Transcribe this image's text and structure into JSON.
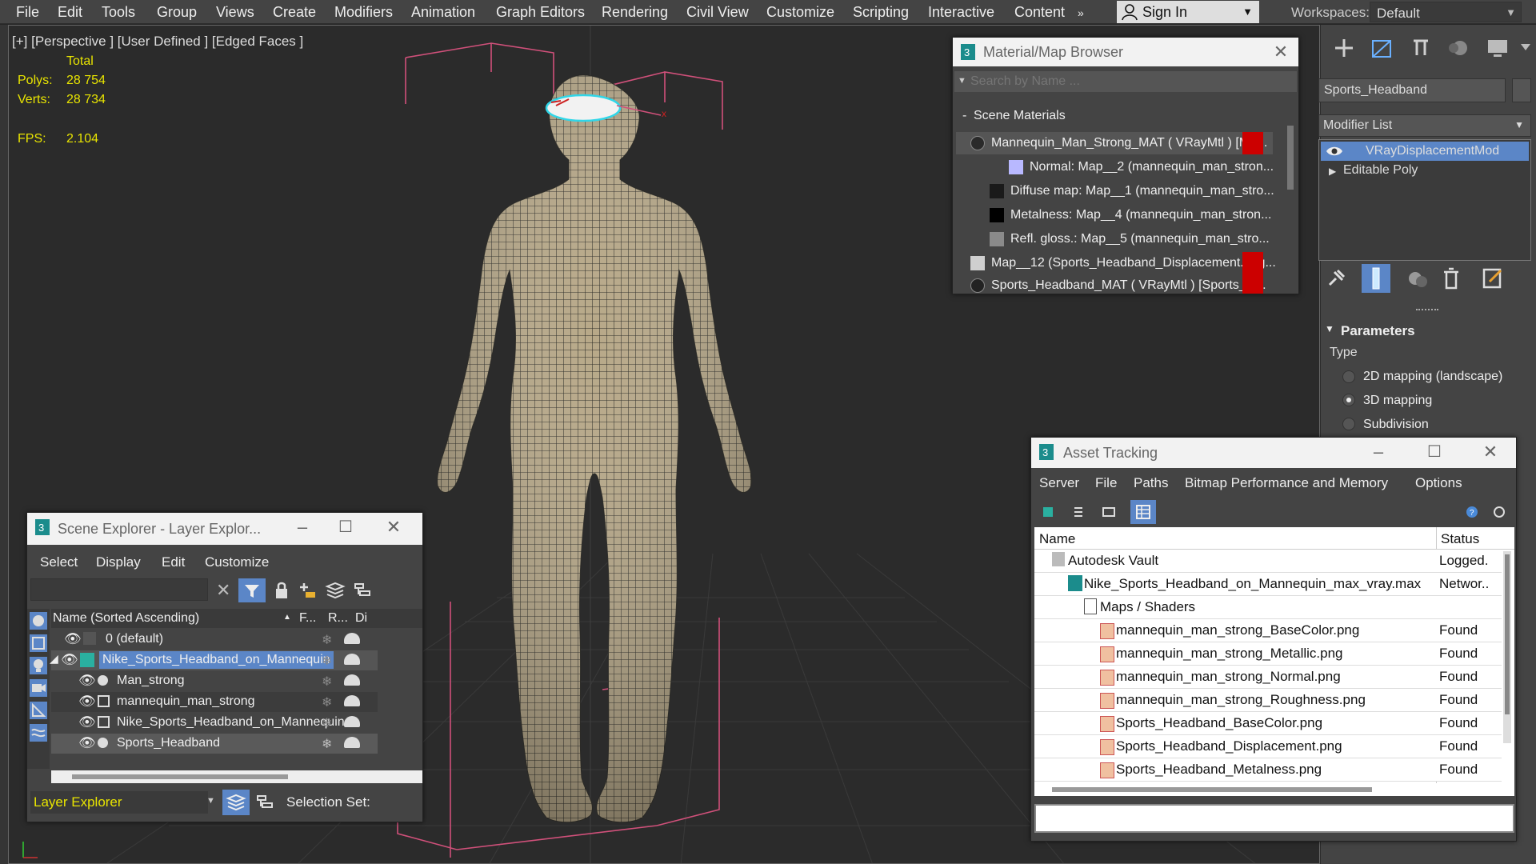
{
  "menubar": {
    "items": [
      "File",
      "Edit",
      "Tools",
      "Group",
      "Views",
      "Create",
      "Modifiers",
      "Animation",
      "Graph Editors",
      "Rendering",
      "Civil View",
      "Customize",
      "Scripting",
      "Interactive",
      "Content"
    ],
    "overflow": "»",
    "sign_in": "Sign In",
    "workspaces_label": "Workspaces:",
    "workspace_value": "Default"
  },
  "viewport": {
    "label": "[+] [Perspective ] [User Defined ] [Edged Faces ]",
    "stats": {
      "total_label": "Total",
      "polys_label": "Polys:",
      "polys_value": "28 754",
      "verts_label": "Verts:",
      "verts_value": "28 734",
      "fps_label": "FPS:",
      "fps_value": "2.104"
    }
  },
  "command_panel": {
    "object_name": "Sports_Headband",
    "modifier_list_label": "Modifier List",
    "stack": [
      {
        "label": "VRayDisplacementMod",
        "selected": true
      },
      {
        "label": "Editable Poly",
        "selected": false
      }
    ],
    "rollout_title": "Parameters",
    "type_label": "Type",
    "mapping_options": [
      {
        "label": "2D mapping (landscape)",
        "checked": false
      },
      {
        "label": "3D mapping",
        "checked": true
      },
      {
        "label": "Subdivision",
        "checked": false
      }
    ]
  },
  "material_browser": {
    "title": "Material/Map Browser",
    "search_placeholder": "Search by Name ...",
    "section": "Scene Materials",
    "items": [
      {
        "label": "Mannequin_Man_Strong_MAT  ( VRayMtl )  [Ma...",
        "swatch": "#2a2a2a"
      },
      {
        "label": "Normal:  Map__2  (mannequin_man_stron...",
        "swatch": "#b8b8ff"
      },
      {
        "label": "Diffuse map:  Map__1  (mannequin_man_stro...",
        "swatch": "#1a1a1a"
      },
      {
        "label": "Metalness:  Map__4  (mannequin_man_stron...",
        "swatch": "#000000"
      },
      {
        "label": "Refl. gloss.:  Map__5  (mannequin_man_stro...",
        "swatch": "#8a8a8a"
      },
      {
        "label": "Map__12  (Sports_Headband_Displacement.png...",
        "swatch": "#cfcfcf"
      },
      {
        "label": "Sports_Headband_MAT  ( VRayMtl )  [Sports_H...",
        "swatch": "#222222"
      }
    ]
  },
  "scene_explorer": {
    "title": "Scene Explorer - Layer Explor...",
    "menus": [
      "Select",
      "Display",
      "Edit",
      "Customize"
    ],
    "columns": [
      "Name (Sorted Ascending)",
      "F...",
      "R...",
      "Di"
    ],
    "rows": [
      {
        "label": "0 (default)",
        "depth": 0
      },
      {
        "label": "Nike_Sports_Headband_on_Mannequin",
        "depth": 0
      },
      {
        "label": "Man_strong",
        "depth": 1
      },
      {
        "label": "mannequin_man_strong",
        "depth": 1
      },
      {
        "label": "Nike_Sports_Headband_on_Mannequin",
        "depth": 1
      },
      {
        "label": "Sports_Headband",
        "depth": 1
      }
    ],
    "footer_layer": "Layer Explorer",
    "selection_set_label": "Selection Set:"
  },
  "asset_tracking": {
    "title": "Asset Tracking",
    "menus": [
      "Server",
      "File",
      "Paths",
      "Bitmap Performance and Memory",
      "Options"
    ],
    "columns": [
      "Name",
      "Status"
    ],
    "rows": [
      {
        "name": "Autodesk Vault",
        "status": "Logged."
      },
      {
        "name": "Nike_Sports_Headband_on_Mannequin_max_vray.max",
        "status": "Networ.."
      },
      {
        "name": "Maps / Shaders",
        "status": ""
      },
      {
        "name": "mannequin_man_strong_BaseColor.png",
        "status": "Found"
      },
      {
        "name": "mannequin_man_strong_Metallic.png",
        "status": "Found"
      },
      {
        "name": "mannequin_man_strong_Normal.png",
        "status": "Found"
      },
      {
        "name": "mannequin_man_strong_Roughness.png",
        "status": "Found"
      },
      {
        "name": "Sports_Headband_BaseColor.png",
        "status": "Found"
      },
      {
        "name": "Sports_Headband_Displacement.png",
        "status": "Found"
      },
      {
        "name": "Sports_Headband_Metalness.png",
        "status": "Found"
      }
    ]
  },
  "colors": {
    "accent_selection": "#5b86c7",
    "stats_yellow": "#e8e400",
    "bbox_pink": "#d0507a",
    "mesh_tone": "#b9a98a"
  }
}
